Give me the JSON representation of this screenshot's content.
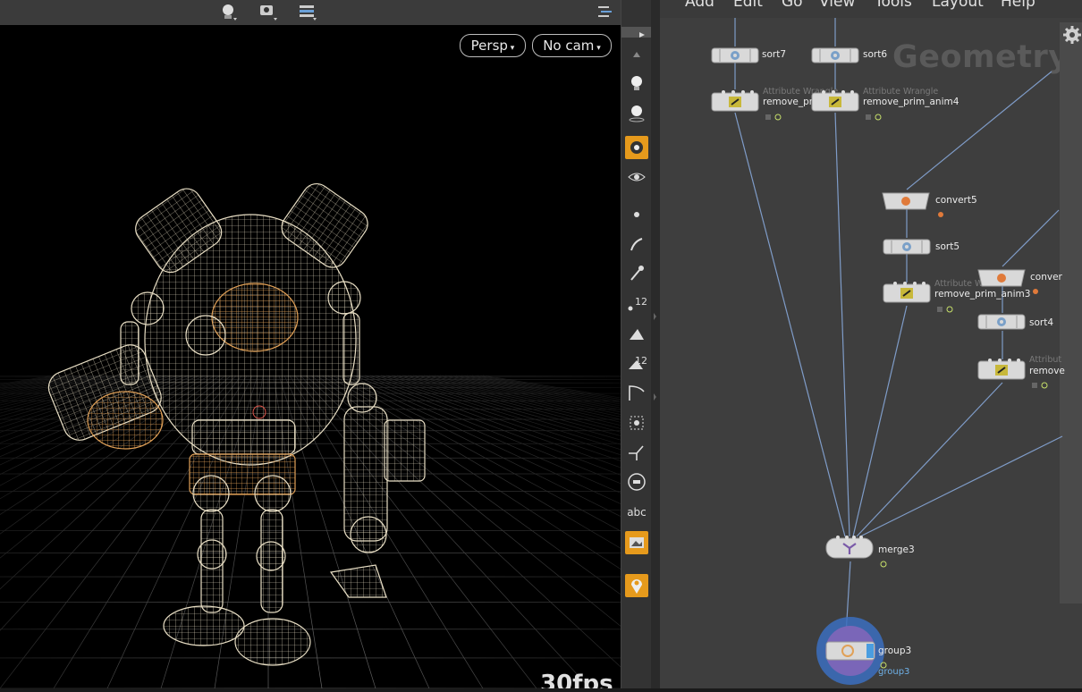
{
  "viewport": {
    "camera_mode": "Persp",
    "camera": "No cam",
    "fps_text": "30fps",
    "toolbar_icons": [
      "light-icon",
      "camera-add-icon",
      "display-options-icon",
      "display-settings-icon",
      "help-icon"
    ]
  },
  "shelf": {
    "tools": [
      "select-icon",
      "handle-icon",
      "view-icon",
      "camera-icon",
      "visibility-icon",
      "point-icon",
      "snap-curve-icon",
      "pin-icon",
      "point-number-icon",
      "prim-icon",
      "prim-number-icon",
      "curve-icon",
      "grid-icon",
      "normal-icon",
      "circle-button-icon",
      "abc-label",
      "background-icon",
      "marker-icon"
    ],
    "abc_label": "abc"
  },
  "network": {
    "menu": [
      "Add",
      "Edit",
      "Go",
      "View",
      "Tools",
      "Layout",
      "Help"
    ],
    "context_title": "Geometry",
    "nodes": {
      "sort7": "sort7",
      "sort6": "sort6",
      "wrangle_type": "Attribute Wrangle",
      "remove_prim_left": "remove_pri",
      "remove_prim_anim4": "remove_prim_anim4",
      "convert5": "convert5",
      "sort5": "sort5",
      "wrangle_type_partial": "Attribute W",
      "remove_prim_anim3": "remove_prim_anim3",
      "convert_right": "conver",
      "sort4": "sort4",
      "wrangle_type_right": "Attribut",
      "remove_right": "remove",
      "merge3": "merge3",
      "group3": "group3",
      "group3_sub": "group3"
    }
  },
  "colors": {
    "accent": "#e69a1c",
    "wire": "#7f9cc8",
    "node_body": "#d9d9d9",
    "group_ring": "#3b6fc0",
    "wireframe": "#e9dfc5",
    "highlight": "#e0a057"
  }
}
